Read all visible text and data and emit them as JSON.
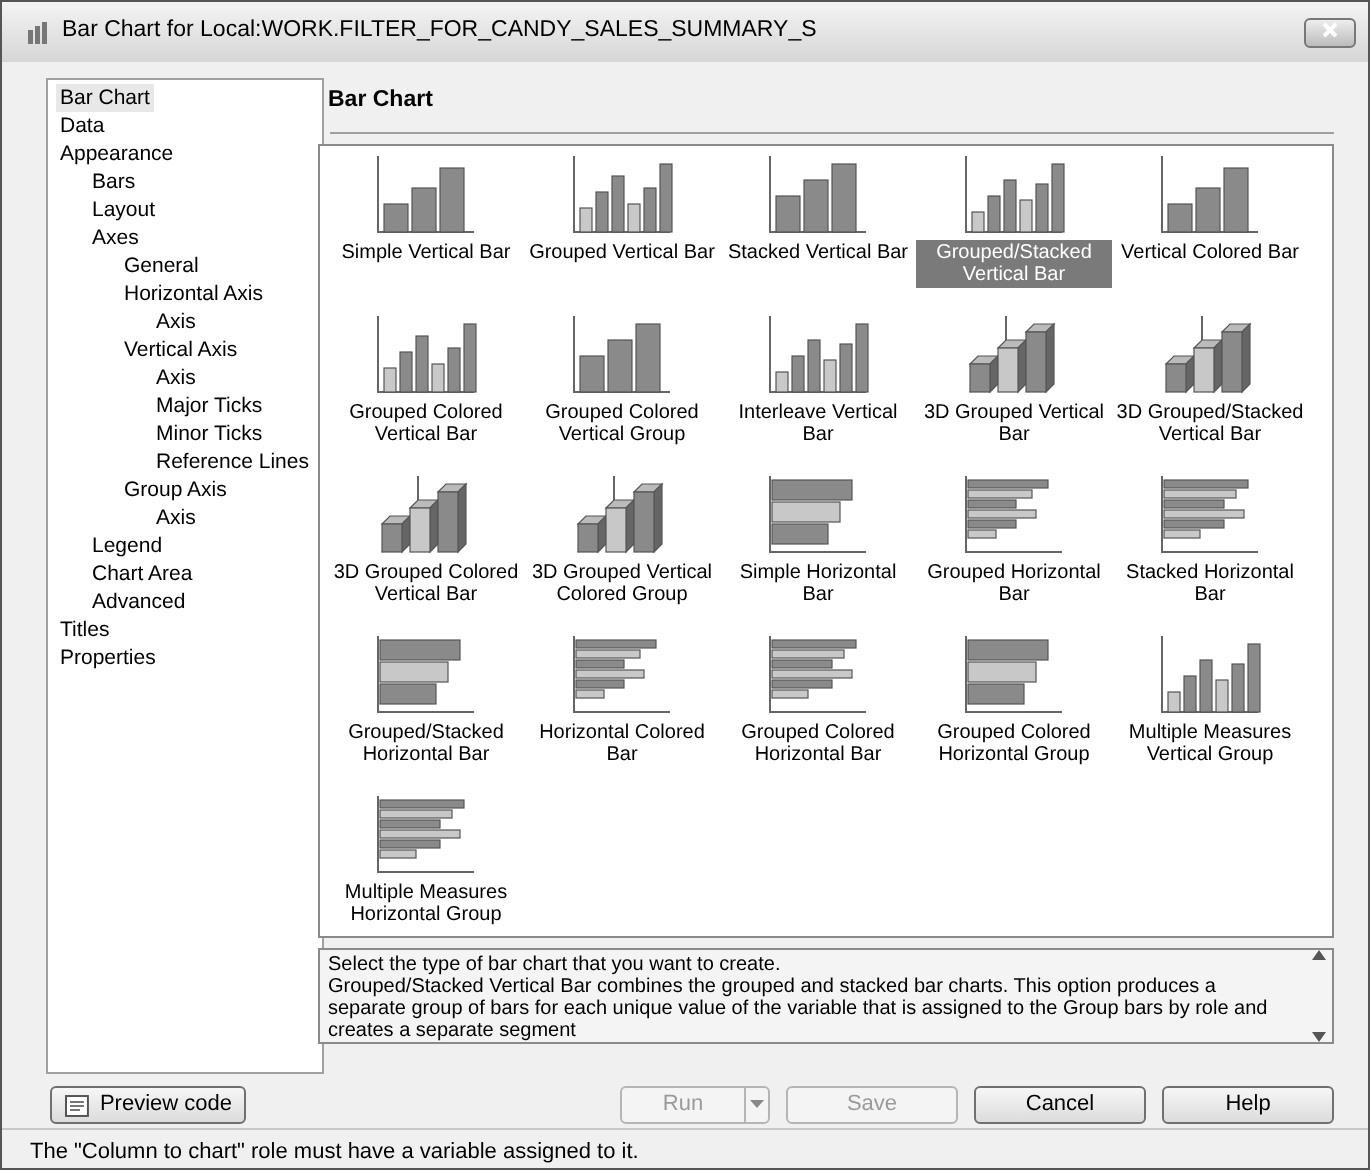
{
  "window": {
    "title": "Bar Chart for Local:WORK.FILTER_FOR_CANDY_SALES_SUMMARY_S"
  },
  "tree": [
    {
      "label": "Bar Chart",
      "selected": true
    },
    {
      "label": "Data",
      "selected": false
    },
    {
      "label": "Appearance",
      "selected": false,
      "children": [
        {
          "label": "Bars",
          "selected": false
        },
        {
          "label": "Layout",
          "selected": false
        },
        {
          "label": "Axes",
          "selected": false,
          "children": [
            {
              "label": "General",
              "selected": false
            },
            {
              "label": "Horizontal Axis",
              "selected": false,
              "children": [
                {
                  "label": "Axis",
                  "selected": false
                }
              ]
            },
            {
              "label": "Vertical Axis",
              "selected": false,
              "children": [
                {
                  "label": "Axis",
                  "selected": false
                },
                {
                  "label": "Major Ticks",
                  "selected": false
                },
                {
                  "label": "Minor Ticks",
                  "selected": false
                },
                {
                  "label": "Reference Lines",
                  "selected": false
                }
              ]
            },
            {
              "label": "Group Axis",
              "selected": false,
              "children": [
                {
                  "label": "Axis",
                  "selected": false
                }
              ]
            }
          ]
        },
        {
          "label": "Legend",
          "selected": false
        },
        {
          "label": "Chart Area",
          "selected": false
        },
        {
          "label": "Advanced",
          "selected": false
        }
      ]
    },
    {
      "label": "Titles",
      "selected": false
    },
    {
      "label": "Properties",
      "selected": false
    }
  ],
  "panel": {
    "heading": "Bar Chart"
  },
  "chart_types": [
    {
      "label": "Simple Vertical Bar",
      "kind": "vertical",
      "selected": false
    },
    {
      "label": "Grouped Vertical Bar",
      "kind": "vertical",
      "selected": false
    },
    {
      "label": "Stacked Vertical Bar",
      "kind": "vertical",
      "selected": false
    },
    {
      "label": "Grouped/Stacked Vertical Bar",
      "kind": "vertical",
      "selected": true
    },
    {
      "label": "Vertical Colored Bar",
      "kind": "vertical",
      "selected": false
    },
    {
      "label": "Grouped Colored Vertical Bar",
      "kind": "vertical",
      "selected": false
    },
    {
      "label": "Grouped Colored Vertical Group",
      "kind": "vertical",
      "selected": false
    },
    {
      "label": "Interleave Vertical Bar",
      "kind": "vertical",
      "selected": false
    },
    {
      "label": "3D Grouped Vertical Bar",
      "kind": "perspective",
      "selected": false
    },
    {
      "label": "3D Grouped/Stacked Vertical Bar",
      "kind": "perspective",
      "selected": false
    },
    {
      "label": "3D Grouped Colored Vertical Bar",
      "kind": "perspective",
      "selected": false
    },
    {
      "label": "3D Grouped Vertical Colored Group",
      "kind": "perspective",
      "selected": false
    },
    {
      "label": "Simple Horizontal Bar",
      "kind": "horizontal",
      "selected": false
    },
    {
      "label": "Grouped Horizontal Bar",
      "kind": "horizontal",
      "selected": false
    },
    {
      "label": "Stacked Horizontal Bar",
      "kind": "horizontal",
      "selected": false
    },
    {
      "label": "Grouped/Stacked Horizontal Bar",
      "kind": "horizontal",
      "selected": false
    },
    {
      "label": "Horizontal Colored Bar",
      "kind": "horizontal",
      "selected": false
    },
    {
      "label": "Grouped Colored Horizontal Bar",
      "kind": "horizontal",
      "selected": false
    },
    {
      "label": "Grouped Colored Horizontal Group",
      "kind": "horizontal",
      "selected": false
    },
    {
      "label": "Multiple Measures Vertical Group",
      "kind": "vertical",
      "selected": false
    },
    {
      "label": "Multiple Measures Horizontal Group",
      "kind": "horizontal",
      "selected": false
    }
  ],
  "description": [
    "Select the type of bar chart that you want to create.",
    "Grouped/Stacked Vertical Bar combines the grouped and stacked bar charts. This option produces a separate group of bars for each unique value of the variable that is assigned to the Group bars by role and creates a separate segment"
  ],
  "buttons": {
    "preview": {
      "label": "Preview code"
    },
    "actions": [
      {
        "label": "Run",
        "disabled": true,
        "kind": "split"
      },
      {
        "label": "Save",
        "disabled": true,
        "kind": "plain"
      },
      {
        "label": "Cancel",
        "disabled": false,
        "kind": "plain"
      },
      {
        "label": "Help",
        "disabled": false,
        "kind": "plain"
      }
    ]
  },
  "status_bar": "The \"Column to chart\" role must have a variable assigned to it."
}
